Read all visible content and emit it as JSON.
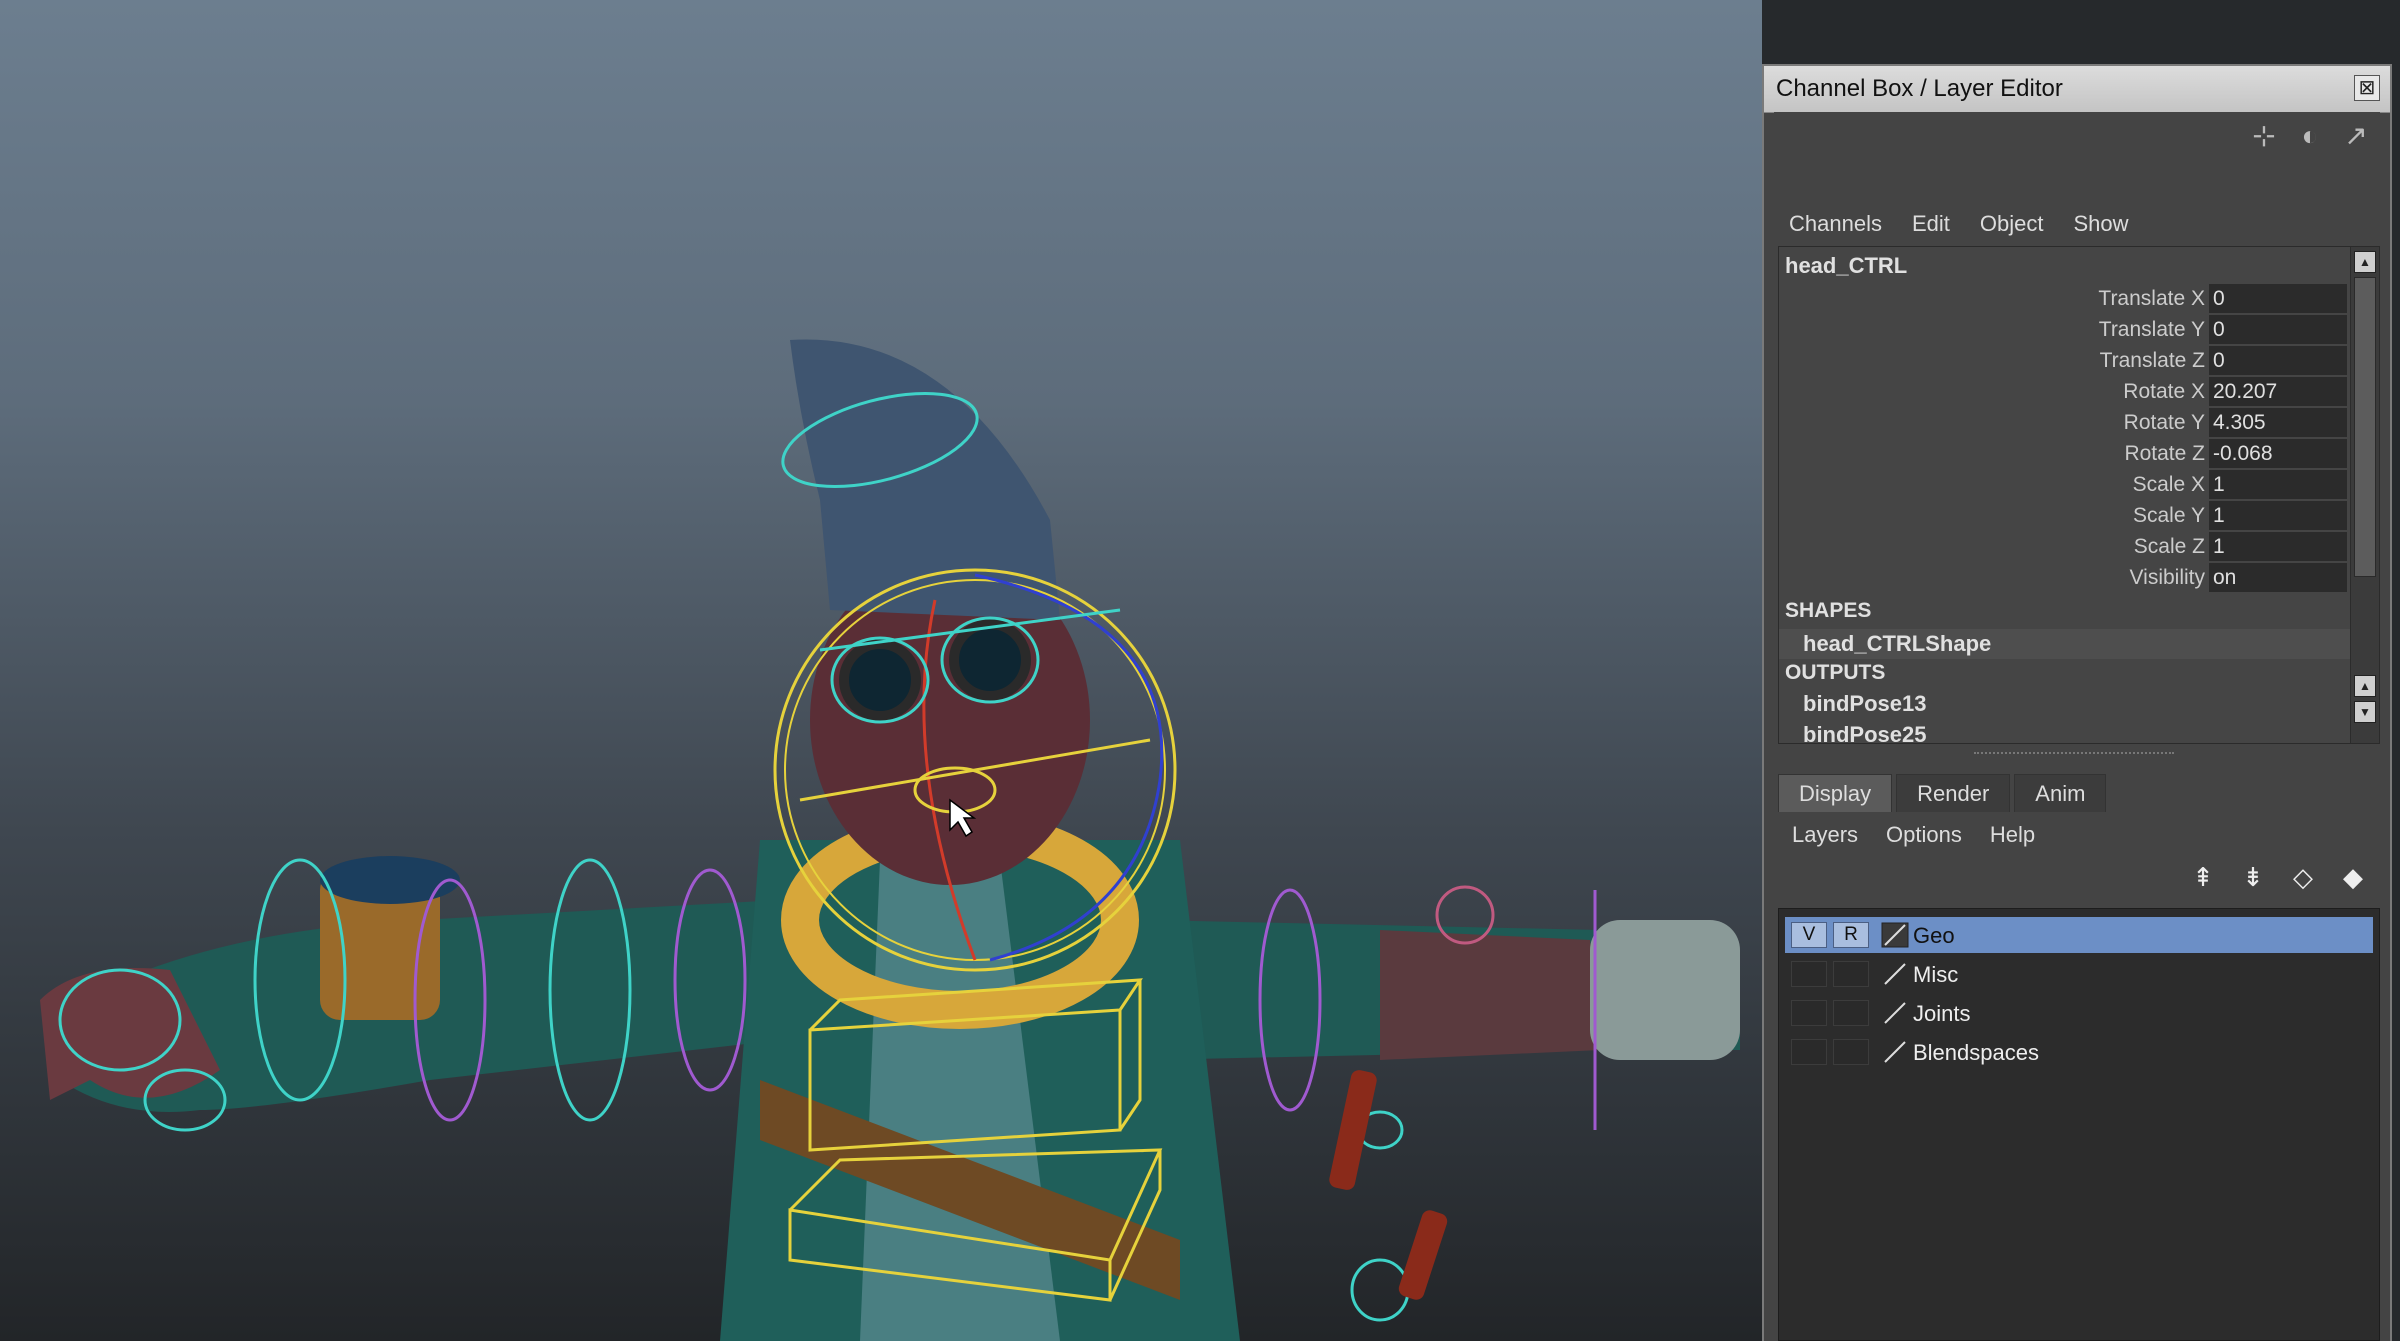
{
  "window": {
    "title": "Channel Box / Layer Editor",
    "close_glyph": "⊠"
  },
  "channel_box": {
    "menu": [
      "Channels",
      "Edit",
      "Object",
      "Show"
    ],
    "node": "head_CTRL",
    "attributes": [
      {
        "label": "Translate X",
        "value": "0"
      },
      {
        "label": "Translate Y",
        "value": "0"
      },
      {
        "label": "Translate Z",
        "value": "0"
      },
      {
        "label": "Rotate X",
        "value": "20.207"
      },
      {
        "label": "Rotate Y",
        "value": "4.305"
      },
      {
        "label": "Rotate Z",
        "value": "-0.068"
      },
      {
        "label": "Scale X",
        "value": "1"
      },
      {
        "label": "Scale Y",
        "value": "1"
      },
      {
        "label": "Scale Z",
        "value": "1"
      },
      {
        "label": "Visibility",
        "value": "on"
      }
    ],
    "shapes_header": "SHAPES",
    "shape": "head_CTRLShape",
    "outputs_header": "OUTPUTS",
    "outputs": [
      "bindPose13",
      "bindPose25"
    ]
  },
  "layer_editor": {
    "tabs": [
      "Display",
      "Render",
      "Anim"
    ],
    "active_tab": "Display",
    "menu": [
      "Layers",
      "Options",
      "Help"
    ],
    "layers": [
      {
        "v": "V",
        "r": "R",
        "name": "Geo",
        "selected": true
      },
      {
        "v": "",
        "r": "",
        "name": "Misc",
        "selected": false
      },
      {
        "v": "",
        "r": "",
        "name": "Joints",
        "selected": false
      },
      {
        "v": "",
        "r": "",
        "name": "Blendspaces",
        "selected": false
      }
    ]
  },
  "colors": {
    "selection": "#6c8fc6",
    "rig_yellow": "#e6d23c",
    "rig_cyan": "#3fd3c8",
    "rig_magenta": "#a05ad0"
  }
}
